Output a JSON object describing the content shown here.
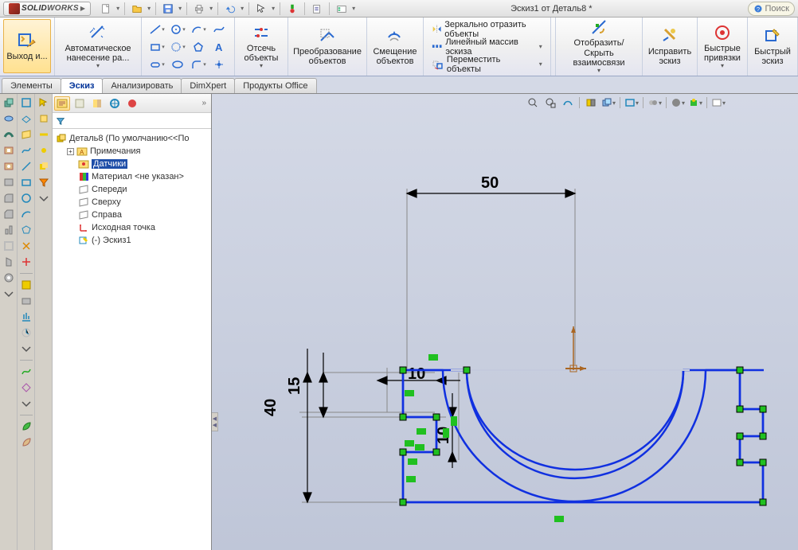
{
  "app": {
    "name": "SOLIDWORKS",
    "title": "Эскиз1 от Деталь8 *",
    "search_prompt": "Поиск"
  },
  "ribbon": {
    "exit": "Выход и...",
    "autodim": "Автоматическое нанесение ра...",
    "trim": "Отсечь объекты",
    "convert": "Преобразование объектов",
    "offset": "Смещение объектов",
    "mirror": "Зеркально отразить объекты",
    "linear": "Линейный массив эскиза",
    "move": "Переместить объекты",
    "showhide": "Отобразить/Скрыть взаимосвязи",
    "repair": "Исправить эскиз",
    "snaps": "Быстрые привязки",
    "quick": "Быстрый эскиз"
  },
  "tabs": {
    "elements": "Элементы",
    "sketch": "Эскиз",
    "analyze": "Анализировать",
    "dimxpert": "DimXpert",
    "office": "Продукты Office"
  },
  "tree": {
    "root": "Деталь8  (По умолчанию<<По",
    "annotations": "Примечания",
    "sensors": "Датчики",
    "material": "Материал <не указан>",
    "front": "Спереди",
    "top": "Сверху",
    "right": "Справа",
    "origin": "Исходная точка",
    "sketch1": "(-) Эскиз1"
  },
  "dims": {
    "d50": "50",
    "d40": "40",
    "d15": "15",
    "d10a": "10",
    "d10b": "10"
  }
}
